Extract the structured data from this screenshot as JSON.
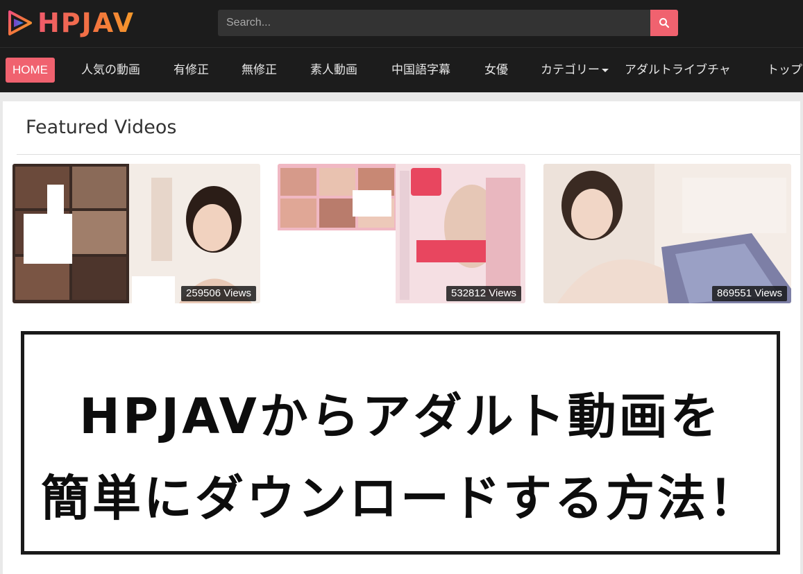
{
  "header": {
    "logo_text": "HPJAV",
    "search_placeholder": "Search...",
    "search_icon": "search-icon"
  },
  "nav": {
    "items": [
      {
        "label": "HOME",
        "active": true
      },
      {
        "label": "人気の動画"
      },
      {
        "label": "有修正"
      },
      {
        "label": "無修正"
      },
      {
        "label": "素人動画"
      },
      {
        "label": "中国語字幕"
      },
      {
        "label": "女優"
      },
      {
        "label": "カテゴリー",
        "dropdown": true
      },
      {
        "label": "アダルトライブチャ"
      },
      {
        "label": "トップ"
      }
    ]
  },
  "featured": {
    "title": "Featured Videos",
    "videos": [
      {
        "views": "259506 Views"
      },
      {
        "views": "532812 Views"
      },
      {
        "views": "869551 Views"
      }
    ]
  },
  "banner": {
    "line1": "HPJAVからアダルト動画を",
    "line2": "簡単にダウンロードする方法！"
  },
  "colors": {
    "accent": "#f0626f",
    "header_bg": "#1c1c1c",
    "search_bg": "#333333"
  }
}
